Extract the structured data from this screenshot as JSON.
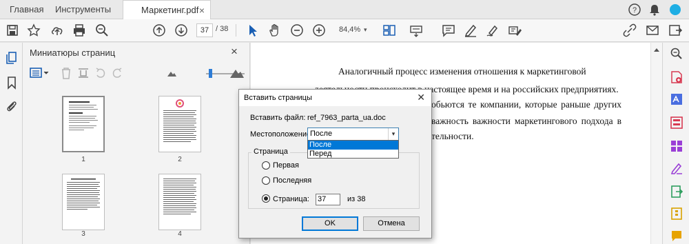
{
  "tabs": {
    "home": "Главная",
    "tools": "Инструменты",
    "document": "Маркетинг.pdf",
    "close": "×"
  },
  "toolbar": {
    "current_page": "37",
    "total_pages": "/ 38",
    "zoom": "84,4%",
    "zoom_caret": "▾"
  },
  "panel": {
    "title": "Миниатюры страниц",
    "close": "×",
    "thumbnails": [
      "1",
      "2",
      "3",
      "4"
    ]
  },
  "document": {
    "lines": [
      "Аналогичный процесс изменения отношения к маркетинговой",
      "деятельности происходит в настоящее время и на российских предприятиях.",
      "обьются те компании, которые раньше других",
      "важность важности маркетингового подхода в",
      "тельности."
    ]
  },
  "dialog": {
    "title": "Вставить страницы",
    "close": "✕",
    "file_label": "Вставить файл:",
    "file_name": "ref_7963_parta_ua.doc",
    "location_label": "Местоположение:",
    "location_value": "После",
    "location_options": [
      "После",
      "Перед"
    ],
    "group_label": "Страница",
    "radio_first": "Первая",
    "radio_last": "Последняя",
    "radio_page": "Страница:",
    "page_value": "37",
    "of_text": "из 38",
    "ok": "OK",
    "cancel": "Отмена"
  },
  "colors": {
    "accent": "#0078d7",
    "highlight": "#2d7cd6"
  }
}
